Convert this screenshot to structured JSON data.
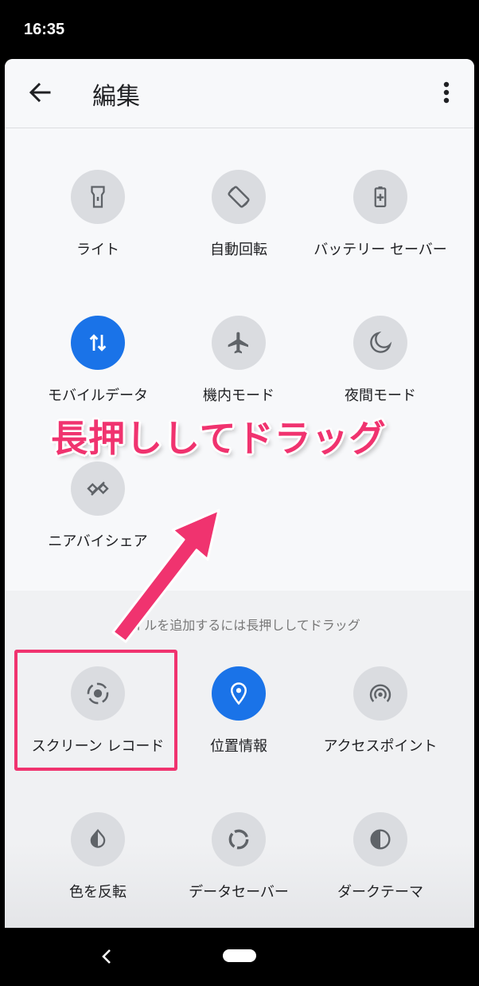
{
  "status_bar": {
    "time": "16:35"
  },
  "app_bar": {
    "title": "編集"
  },
  "active_tiles": [
    {
      "label": "ライト",
      "icon": "flashlight-icon",
      "active": false
    },
    {
      "label": "自動回転",
      "icon": "auto-rotate-icon",
      "active": false
    },
    {
      "label": "バッテリー セーバー",
      "icon": "battery-saver-icon",
      "active": false
    },
    {
      "label": "モバイルデータ",
      "icon": "mobile-data-icon",
      "active": true
    },
    {
      "label": "機内モード",
      "icon": "airplane-icon",
      "active": false
    },
    {
      "label": "夜間モード",
      "icon": "moon-icon",
      "active": false
    },
    {
      "label": "ニアバイシェア",
      "icon": "nearby-share-icon",
      "active": false
    }
  ],
  "hint": "タイルを追加するには長押ししてドラッグ",
  "available_tiles": [
    {
      "label": "スクリーン レコード",
      "icon": "screen-record-icon",
      "active": false
    },
    {
      "label": "位置情報",
      "icon": "location-icon",
      "active": true
    },
    {
      "label": "アクセスポイント",
      "icon": "hotspot-icon",
      "active": false
    },
    {
      "label": "色を反転",
      "icon": "invert-colors-icon",
      "active": false
    },
    {
      "label": "データセーバー",
      "icon": "data-saver-icon",
      "active": false
    },
    {
      "label": "ダークテーマ",
      "icon": "dark-theme-icon",
      "active": false
    }
  ],
  "overlay": {
    "caption": "長押ししてドラッグ",
    "accent_color": "#f0336f"
  },
  "colors": {
    "tile_on": "#1a73e8",
    "tile_off": "#dadce0",
    "icon": "#5f6368"
  }
}
